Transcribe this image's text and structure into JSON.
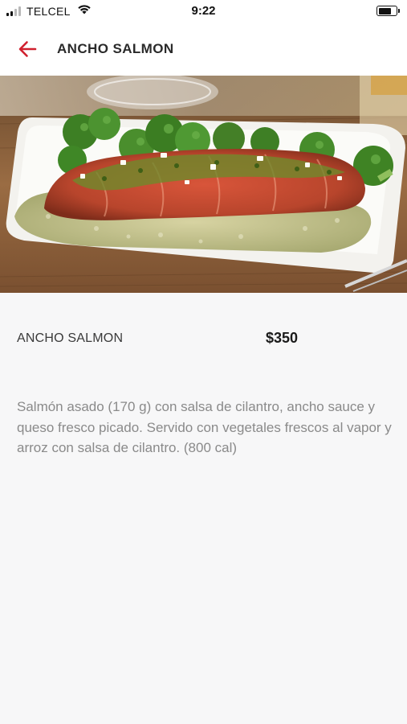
{
  "status_bar": {
    "carrier": "TELCEL",
    "time": "9:22",
    "icons": [
      "signal-icon",
      "wifi-icon",
      "battery-icon"
    ]
  },
  "header": {
    "title": "ANCHO SALMON",
    "back_icon": "arrow-left-icon"
  },
  "hero": {
    "image": "salmon-dish-photo"
  },
  "item": {
    "name": "ANCHO SALMON",
    "price": "$350",
    "description": "Salmón asado (170 g) con salsa de cilantro, ancho sauce y queso fresco picado. Servido con vegetales frescos al vapor y arroz con salsa de cilantro. (800 cal)"
  },
  "colors": {
    "accent": "#d0202e",
    "background": "#f7f7f8",
    "description_text": "#8a8a8a"
  }
}
